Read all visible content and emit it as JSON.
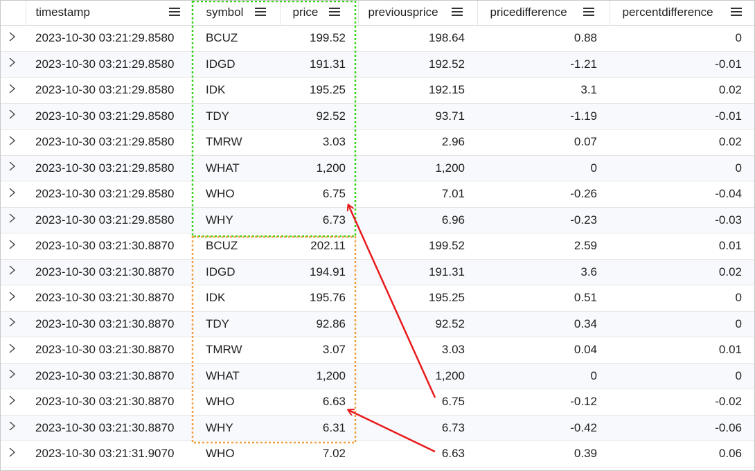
{
  "columns": [
    {
      "key": "timestamp",
      "label": "timestamp"
    },
    {
      "key": "symbol",
      "label": "symbol"
    },
    {
      "key": "price",
      "label": "price"
    },
    {
      "key": "previousprice",
      "label": "previousprice"
    },
    {
      "key": "pricedifference",
      "label": "pricedifference"
    },
    {
      "key": "percentdifference",
      "label": "percentdifference"
    }
  ],
  "rows": [
    [
      "2023-10-30 03:21:29.8580",
      "BCUZ",
      "199.52",
      "198.64",
      "0.88",
      "0"
    ],
    [
      "2023-10-30 03:21:29.8580",
      "IDGD",
      "191.31",
      "192.52",
      "-1.21",
      "-0.01"
    ],
    [
      "2023-10-30 03:21:29.8580",
      "IDK",
      "195.25",
      "192.15",
      "3.1",
      "0.02"
    ],
    [
      "2023-10-30 03:21:29.8580",
      "TDY",
      "92.52",
      "93.71",
      "-1.19",
      "-0.01"
    ],
    [
      "2023-10-30 03:21:29.8580",
      "TMRW",
      "3.03",
      "2.96",
      "0.07",
      "0.02"
    ],
    [
      "2023-10-30 03:21:29.8580",
      "WHAT",
      "1,200",
      "1,200",
      "0",
      "0"
    ],
    [
      "2023-10-30 03:21:29.8580",
      "WHO",
      "6.75",
      "7.01",
      "-0.26",
      "-0.04"
    ],
    [
      "2023-10-30 03:21:29.8580",
      "WHY",
      "6.73",
      "6.96",
      "-0.23",
      "-0.03"
    ],
    [
      "2023-10-30 03:21:30.8870",
      "BCUZ",
      "202.11",
      "199.52",
      "2.59",
      "0.01"
    ],
    [
      "2023-10-30 03:21:30.8870",
      "IDGD",
      "194.91",
      "191.31",
      "3.6",
      "0.02"
    ],
    [
      "2023-10-30 03:21:30.8870",
      "IDK",
      "195.76",
      "195.25",
      "0.51",
      "0"
    ],
    [
      "2023-10-30 03:21:30.8870",
      "TDY",
      "92.86",
      "92.52",
      "0.34",
      "0"
    ],
    [
      "2023-10-30 03:21:30.8870",
      "TMRW",
      "3.07",
      "3.03",
      "0.04",
      "0.01"
    ],
    [
      "2023-10-30 03:21:30.8870",
      "WHAT",
      "1,200",
      "1,200",
      "0",
      "0"
    ],
    [
      "2023-10-30 03:21:30.8870",
      "WHO",
      "6.63",
      "6.75",
      "-0.12",
      "-0.02"
    ],
    [
      "2023-10-30 03:21:30.8870",
      "WHY",
      "6.31",
      "6.73",
      "-0.42",
      "-0.06"
    ],
    [
      "2023-10-30 03:21:31.9070",
      "WHO",
      "7.02",
      "6.63",
      "0.39",
      "0.06"
    ]
  ],
  "annotations": {
    "green_box_color": "#39d41a",
    "orange_box_color": "#f0a040",
    "arrow_color": "#e8191b",
    "icons": {
      "row_expand": "chevron-right-icon",
      "column_menu": "menu-icon"
    }
  }
}
